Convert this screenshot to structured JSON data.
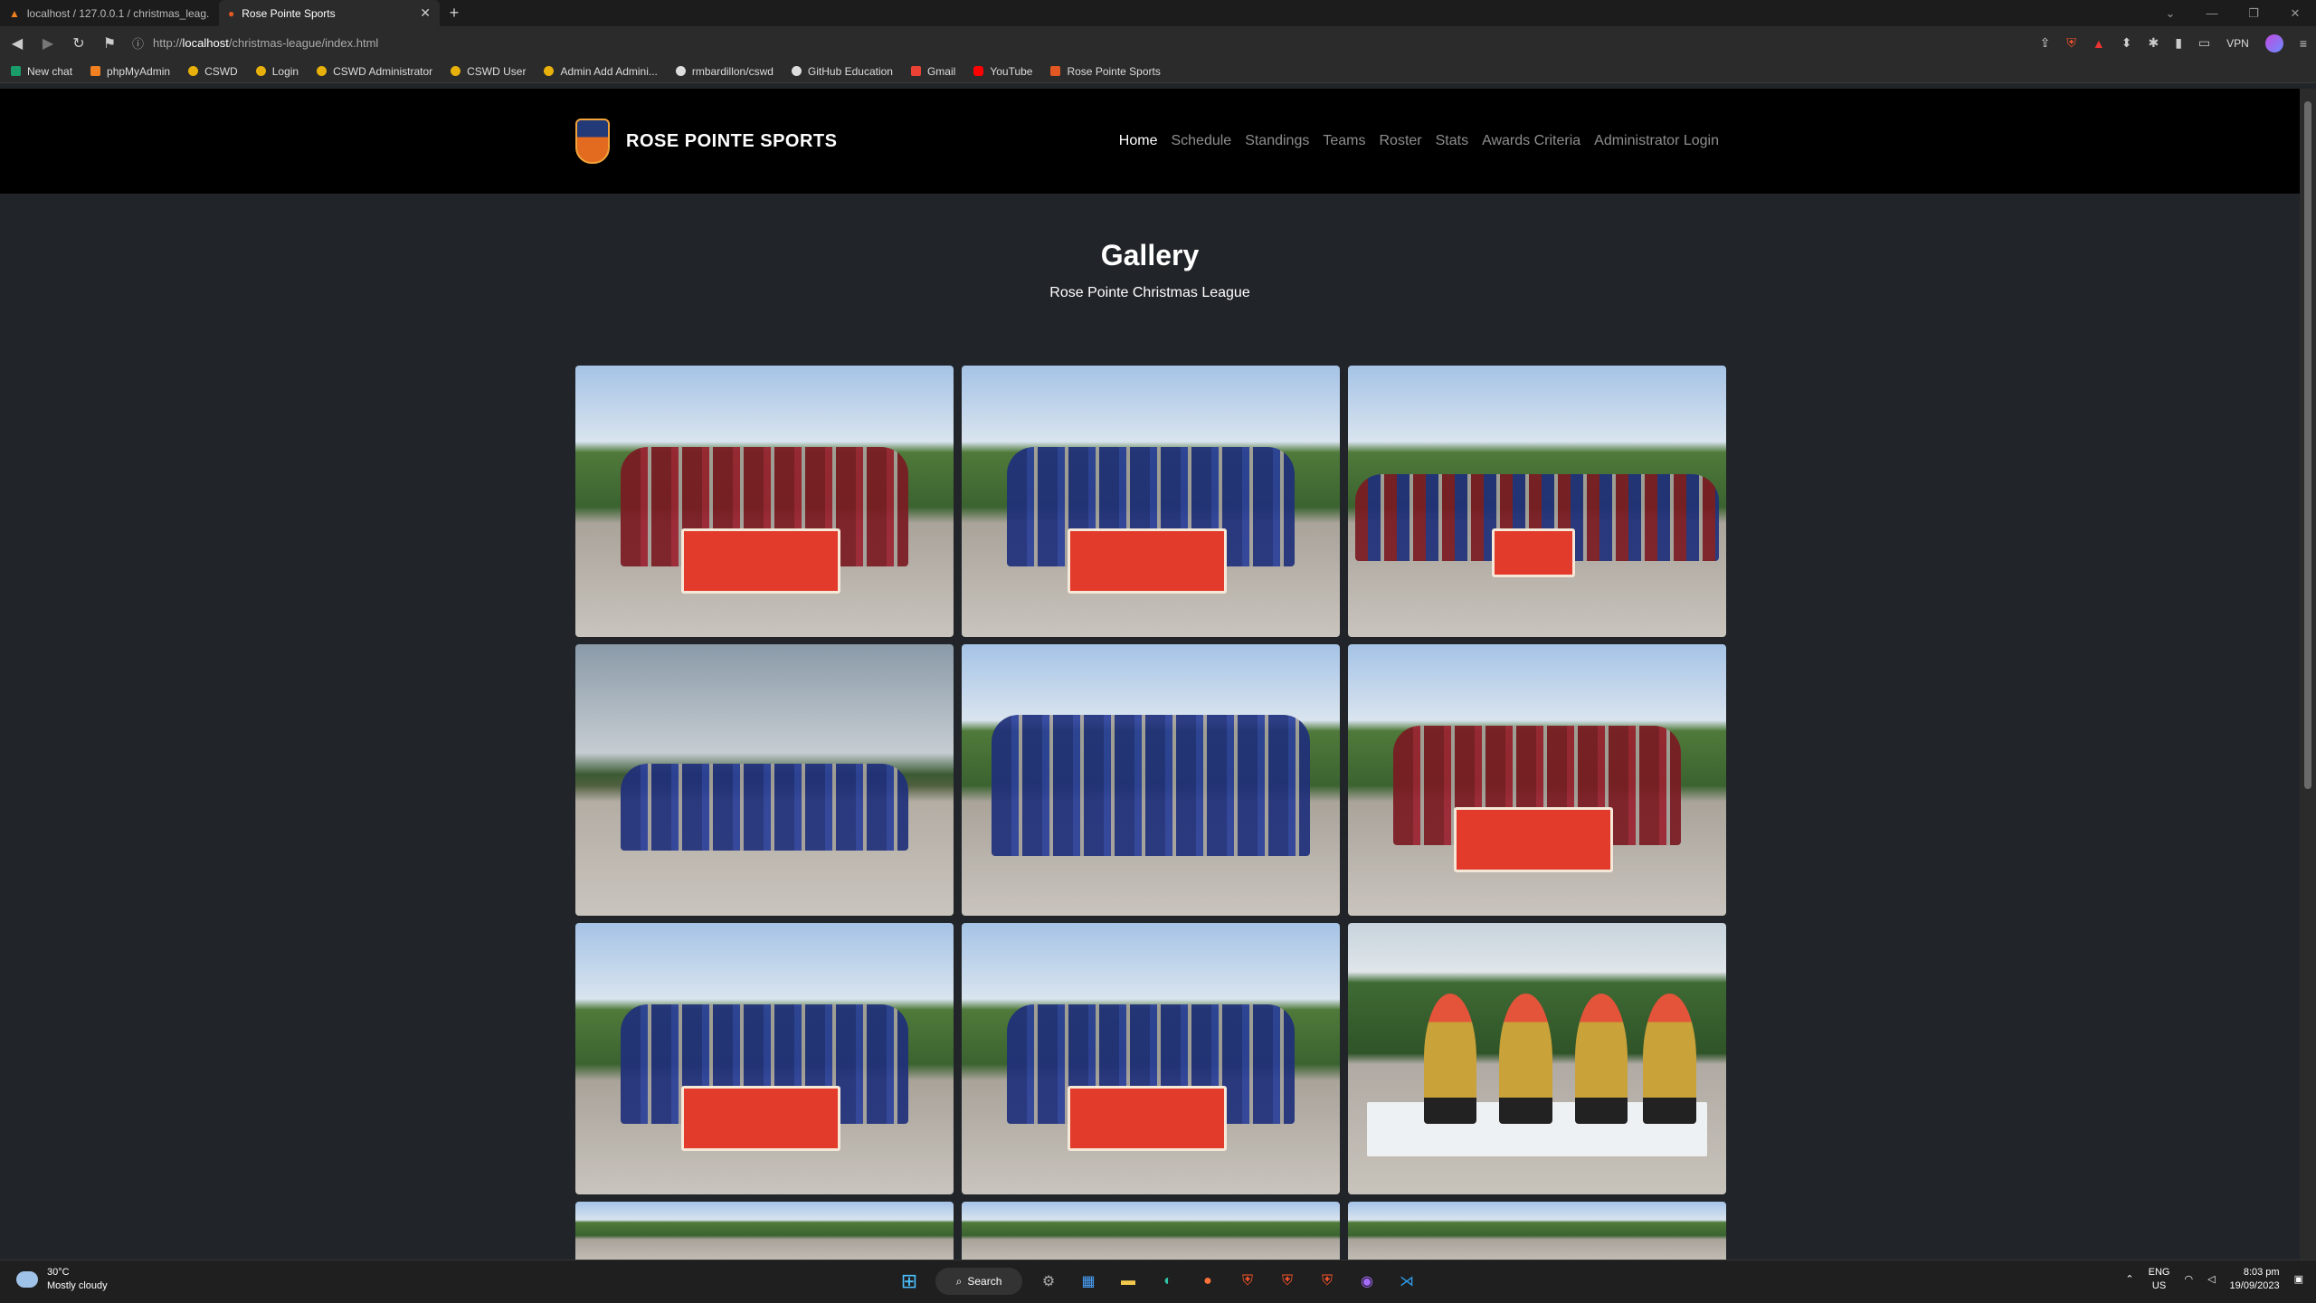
{
  "browser": {
    "tabs": [
      {
        "title": "localhost / 127.0.0.1 / christmas_leag..."
      },
      {
        "title": "Rose Pointe Sports"
      }
    ],
    "url_prefix": "http://",
    "url_host": "localhost",
    "url_path": "/christmas-league/index.html",
    "vpn_label": "VPN",
    "bookmarks": [
      {
        "label": "New chat",
        "icon": "chat-icon"
      },
      {
        "label": "phpMyAdmin",
        "icon": "phpmyadmin-icon"
      },
      {
        "label": "CSWD",
        "icon": "site-icon"
      },
      {
        "label": "Login",
        "icon": "site-icon"
      },
      {
        "label": "CSWD Administrator",
        "icon": "site-icon"
      },
      {
        "label": "CSWD User",
        "icon": "site-icon"
      },
      {
        "label": "Admin Add Admini...",
        "icon": "site-icon"
      },
      {
        "label": "rmbardillon/cswd",
        "icon": "github-icon"
      },
      {
        "label": "GitHub Education",
        "icon": "github-icon"
      },
      {
        "label": "Gmail",
        "icon": "gmail-icon"
      },
      {
        "label": "YouTube",
        "icon": "youtube-icon"
      },
      {
        "label": "Rose Pointe Sports",
        "icon": "site-icon"
      }
    ]
  },
  "site": {
    "brand": "ROSE POINTE SPORTS",
    "nav": [
      {
        "label": "Home",
        "active": true
      },
      {
        "label": "Schedule",
        "active": false
      },
      {
        "label": "Standings",
        "active": false
      },
      {
        "label": "Teams",
        "active": false
      },
      {
        "label": "Roster",
        "active": false
      },
      {
        "label": "Stats",
        "active": false
      },
      {
        "label": "Awards Criteria",
        "active": false
      },
      {
        "label": "Administrator Login",
        "active": false
      }
    ],
    "title": "Gallery",
    "subtitle": "Rose Pointe Christmas League",
    "photos": [
      {
        "desc": "team-red-with-trophies",
        "tone": "red"
      },
      {
        "desc": "team-blue-with-trophies",
        "tone": "blue"
      },
      {
        "desc": "both-teams-group",
        "tone": "mixed"
      },
      {
        "desc": "blue-team-sky",
        "tone": "blue"
      },
      {
        "desc": "blue-team-posing",
        "tone": "blue"
      },
      {
        "desc": "red-team-banner",
        "tone": "red"
      },
      {
        "desc": "blue-team-banner",
        "tone": "blue"
      },
      {
        "desc": "blue-team-banner-2",
        "tone": "blue"
      },
      {
        "desc": "trophies-on-table",
        "tone": "trophy"
      },
      {
        "desc": "partial",
        "tone": "partial"
      },
      {
        "desc": "partial",
        "tone": "partial"
      },
      {
        "desc": "partial",
        "tone": "partial"
      }
    ]
  },
  "taskbar": {
    "weather_temp": "30°C",
    "weather_desc": "Mostly cloudy",
    "search_label": "Search",
    "lang_top": "ENG",
    "lang_bottom": "US",
    "time": "8:03 pm",
    "date": "19/09/2023"
  }
}
